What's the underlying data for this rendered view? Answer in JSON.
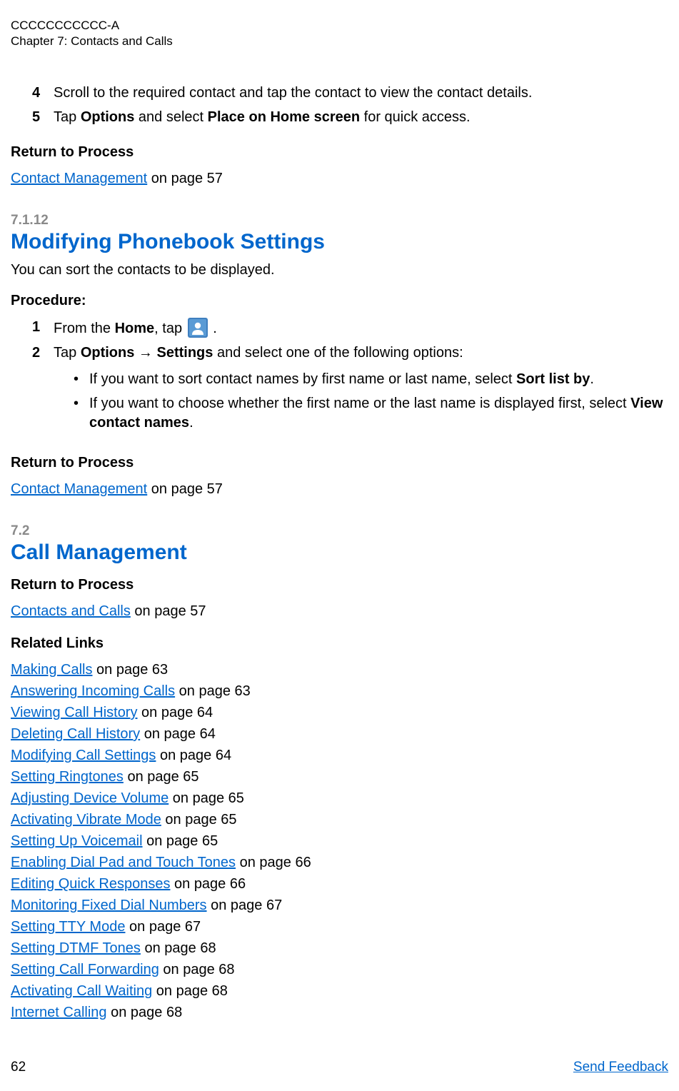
{
  "header": {
    "doc_id": "CCCCCCCCCCC-A",
    "chapter": "Chapter 7:  Contacts and Calls"
  },
  "steps_top": [
    {
      "n": "4",
      "text": "Scroll to the required contact and tap the contact to view the contact details."
    },
    {
      "n": "5",
      "pre": "Tap ",
      "bold1": "Options",
      "mid": " and select ",
      "bold2": "Place on Home screen",
      "post": " for quick access."
    }
  ],
  "rtp1": {
    "label": "Return to Process",
    "link_text": "Contact Management",
    "page_text": " on page 57"
  },
  "sec7112": {
    "num": "7.1.12",
    "title": "Modifying Phonebook Settings",
    "desc": "You can sort the contacts to be displayed.",
    "procedure_label": "Procedure:",
    "step1": {
      "n": "1",
      "pre": "From the ",
      "bold1": "Home",
      "mid": ", tap ",
      "post": " ."
    },
    "step2": {
      "n": "2",
      "pre": "Tap ",
      "bold1": "Options",
      "arrow": " → ",
      "bold2": "Settings",
      "post": " and select one of the following options:"
    },
    "bullets": [
      {
        "pre": "If you want to sort contact names by first name or last name, select ",
        "bold": "Sort list by",
        "post": "."
      },
      {
        "pre": "If you want to choose whether the first name or the last name is displayed first, select ",
        "bold": "View contact names",
        "post": "."
      }
    ],
    "rtp": {
      "label": "Return to Process",
      "link_text": "Contact Management",
      "page_text": " on page 57"
    }
  },
  "sec72": {
    "num": "7.2",
    "title": "Call Management",
    "rtp": {
      "label": "Return to Process",
      "link_text": "Contacts and Calls",
      "page_text": " on page 57"
    },
    "related_label": "Related Links",
    "related_links": [
      {
        "text": "Making Calls",
        "page": " on page 63"
      },
      {
        "text": "Answering Incoming Calls",
        "page": " on page 63"
      },
      {
        "text": "Viewing Call History",
        "page": " on page 64"
      },
      {
        "text": "Deleting Call History",
        "page": " on page 64"
      },
      {
        "text": "Modifying Call Settings",
        "page": " on page 64"
      },
      {
        "text": "Setting Ringtones",
        "page": " on page 65"
      },
      {
        "text": "Adjusting Device Volume",
        "page": " on page 65"
      },
      {
        "text": "Activating Vibrate Mode",
        "page": " on page 65"
      },
      {
        "text": "Setting Up Voicemail",
        "page": " on page 65"
      },
      {
        "text": "Enabling Dial Pad and Touch Tones",
        "page": " on page 66"
      },
      {
        "text": "Editing Quick Responses",
        "page": " on page 66"
      },
      {
        "text": "Monitoring Fixed Dial Numbers",
        "page": " on page 67"
      },
      {
        "text": "Setting TTY Mode",
        "page": " on page 67"
      },
      {
        "text": "Setting DTMF Tones",
        "page": " on page 68"
      },
      {
        "text": "Setting Call Forwarding",
        "page": " on page 68"
      },
      {
        "text": "Activating Call Waiting",
        "page": " on page 68"
      },
      {
        "text": "Internet Calling",
        "page": " on page 68"
      }
    ]
  },
  "footer": {
    "page_num": "62",
    "feedback": "Send Feedback"
  }
}
